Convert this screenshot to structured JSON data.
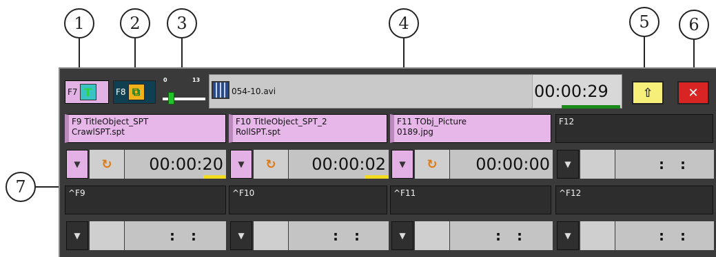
{
  "callouts": [
    "1",
    "2",
    "3",
    "4",
    "5",
    "6",
    "7"
  ],
  "toolbar": {
    "f7": {
      "key": "F7",
      "icon": "title-object-icon"
    },
    "f8": {
      "key": "F8",
      "icon": "loop-color-icon"
    },
    "slider": {
      "min": "0",
      "max": "13",
      "value": 2
    },
    "file": {
      "name": "054-10.avi",
      "time": "00:00:29",
      "progress": 0.95
    },
    "eject_icon": "eject-up-icon",
    "delete_icon": "delete-red-icon"
  },
  "slots": [
    {
      "key": "F9",
      "title": "TitleObject_SPT",
      "file": "CrawlSPT.spt",
      "time": "00:00:20",
      "shortcut": "^F9",
      "ctrl_time": " : : "
    },
    {
      "key": "F10",
      "title": "TitleObject_SPT_2",
      "file": "RollSPT.spt",
      "time": "00:00:02",
      "shortcut": "^F10",
      "ctrl_time": " : : "
    },
    {
      "key": "F11",
      "title": "TObj_Picture",
      "file": "0189.jpg",
      "time": "00:00:00",
      "shortcut": "^F11",
      "ctrl_time": " : : "
    },
    {
      "key": "F12",
      "title": "",
      "file": "",
      "time": ": :",
      "shortcut": "^F12",
      "ctrl_time": " : : "
    }
  ],
  "dropdown_glyph": "▼",
  "loop_glyph": "↻",
  "colors": {
    "pink": "#e7b7ea",
    "dark": "#2d2d2d",
    "accent_green": "#22c22c",
    "accent_yellow": "#f3dc20"
  }
}
